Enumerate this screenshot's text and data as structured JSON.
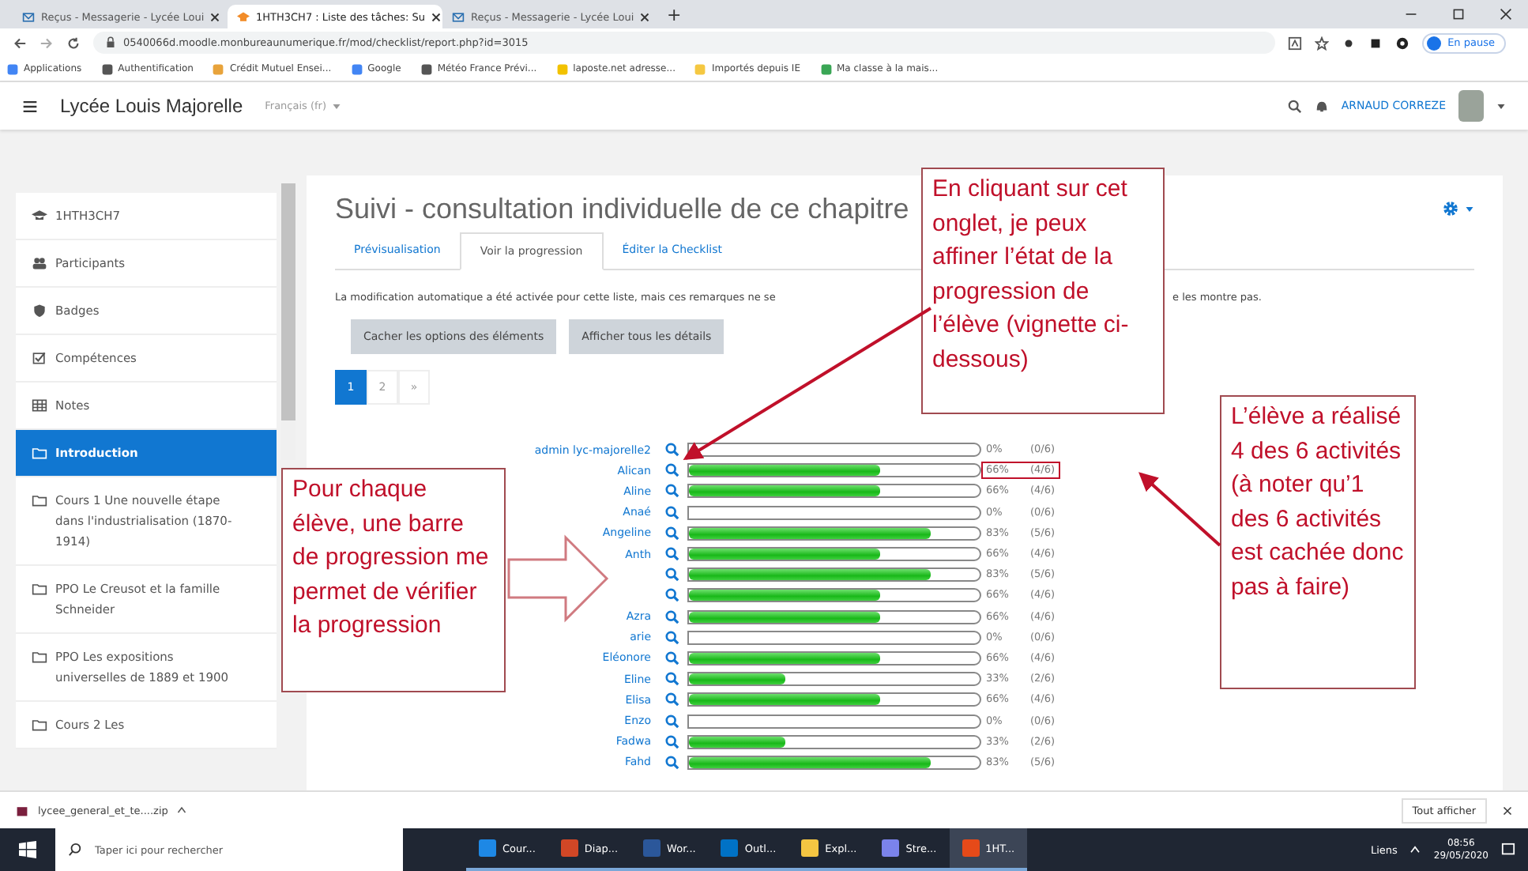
{
  "browser": {
    "tabs": [
      {
        "title": "Reçus - Messagerie - Lycée Loui",
        "kind": "mail",
        "selected": false
      },
      {
        "title": "1HTH3CH7 : Liste des tâches: Su",
        "kind": "course",
        "selected": true
      },
      {
        "title": "Reçus - Messagerie - Lycée Loui",
        "kind": "mail",
        "selected": false
      }
    ],
    "new_tab": "+",
    "url": "0540066d.moodle.monbureaunumerique.fr/mod/checklist/report.php?id=3015",
    "bookmarks": [
      {
        "label": "Applications",
        "color": "#4285f4"
      },
      {
        "label": "Authentification",
        "color": "#555555"
      },
      {
        "label": "Crédit Mutuel Ensei...",
        "color": "#e8a33b"
      },
      {
        "label": "Google",
        "color": "#4285f4"
      },
      {
        "label": "Météo France Prévi...",
        "color": "#555555"
      },
      {
        "label": "laposte.net adresse...",
        "color": "#f2c200"
      },
      {
        "label": "Importés depuis IE",
        "color": "#f5c842"
      },
      {
        "label": "Ma classe à la mais...",
        "color": "#3aa655"
      }
    ],
    "profile_badge": "En pause"
  },
  "header": {
    "site_name": "Lycée Louis Majorelle",
    "language": "Français (fr)",
    "user_name": "ARNAUD CORREZE"
  },
  "sidebar": {
    "items": [
      {
        "label": "1HTH3CH7",
        "kind": "course",
        "selected": false
      },
      {
        "label": "Participants",
        "kind": "participants",
        "selected": false
      },
      {
        "label": "Badges",
        "kind": "badges",
        "selected": false
      },
      {
        "label": "Compétences",
        "kind": "competencies",
        "selected": false
      },
      {
        "label": "Notes",
        "kind": "grades",
        "selected": false
      },
      {
        "label": "Introduction",
        "kind": "section",
        "selected": true
      },
      {
        "label": "Cours 1 Une nouvelle étape dans l'industrialisation (1870-1914)",
        "kind": "section",
        "selected": false
      },
      {
        "label": "PPO Le Creusot et la famille Schneider",
        "kind": "section",
        "selected": false
      },
      {
        "label": "PPO Les expositions universelles de 1889 et 1900",
        "kind": "section",
        "selected": false
      },
      {
        "label": "Cours 2 Les",
        "kind": "section",
        "selected": false
      }
    ]
  },
  "page": {
    "title": "Suivi - consultation individuelle de ce chapitre",
    "tabs": [
      {
        "label": "Prévisualisation",
        "selected": false
      },
      {
        "label": "Voir la progression",
        "selected": true
      },
      {
        "label": "Éditer la Checklist",
        "selected": false
      }
    ],
    "notice_start": "La modification automatique a été activée pour cette liste, mais ces remarques ne se",
    "notice_end": "e les montre pas.",
    "buttons": [
      "Cacher les options des éléments",
      "Afficher tous les détails"
    ],
    "pagination": [
      {
        "label": "1",
        "selected": true
      },
      {
        "label": "2",
        "selected": false
      },
      {
        "label": "»",
        "selected": false
      }
    ],
    "rows": [
      {
        "name": "admin lyc-majorelle2",
        "level": 0,
        "percent": "0%",
        "count": "(0/6)",
        "highlighted": false
      },
      {
        "name": "Alican",
        "level": 0.66,
        "percent": "66%",
        "count": "(4/6)",
        "highlighted": true
      },
      {
        "name": "Aline",
        "level": 0.66,
        "percent": "66%",
        "count": "(4/6)",
        "highlighted": false
      },
      {
        "name": "Anaé",
        "level": 0,
        "percent": "0%",
        "count": "(0/6)",
        "highlighted": false
      },
      {
        "name": "Angeline",
        "level": 0.83,
        "percent": "83%",
        "count": "(5/6)",
        "highlighted": false
      },
      {
        "name": "Anth",
        "level": 0.66,
        "percent": "66%",
        "count": "(4/6)",
        "highlighted": false
      },
      {
        "level": 0.83,
        "percent": "83%",
        "count": "(5/6)",
        "highlighted": false
      },
      {
        "level": 0.66,
        "percent": "66%",
        "count": "(4/6)",
        "highlighted": false
      },
      {
        "name": "Azra",
        "level": 0.66,
        "percent": "66%",
        "count": "(4/6)",
        "highlighted": false
      },
      {
        "name": "arie",
        "level": 0,
        "percent": "0%",
        "count": "(0/6)",
        "highlighted": false
      },
      {
        "name": "Eléonore",
        "level": 0.66,
        "percent": "66%",
        "count": "(4/6)",
        "highlighted": false
      },
      {
        "name": "Eline",
        "level": 0.33,
        "percent": "33%",
        "count": "(2/6)",
        "highlighted": false
      },
      {
        "name": "Elisa",
        "level": 0.66,
        "percent": "66%",
        "count": "(4/6)",
        "highlighted": false
      },
      {
        "name": "Enzo",
        "level": 0,
        "percent": "0%",
        "count": "(0/6)",
        "highlighted": false
      },
      {
        "name": "Fadwa",
        "level": 0.33,
        "percent": "33%",
        "count": "(2/6)",
        "highlighted": false
      },
      {
        "name": "Fahd",
        "level": 0.83,
        "percent": "83%",
        "count": "(5/6)",
        "highlighted": false
      }
    ]
  },
  "annotations": [
    {
      "kind": "callout",
      "text": "En cliquant sur cet onglet, je peux affiner l’état de la progression de l’élève (vignette ci-dessous)"
    },
    {
      "kind": "callout",
      "text": "Pour chaque élève, une barre de progression me permet de vérifier la progression"
    },
    {
      "kind": "callout",
      "text": "L’élève a réalisé 4 des 6 activités (à noter qu’1 des 6 activités est cachée donc pas à faire)"
    }
  ],
  "download_bar": {
    "file": "lycee_general_et_te....zip",
    "show_all": "Tout afficher"
  },
  "taskbar": {
    "search_placeholder": "Taper ici pour rechercher",
    "apps": [
      {
        "label": "Cour...",
        "color": "#1e88e5",
        "selected": false
      },
      {
        "label": "Diap...",
        "color": "#d24726",
        "selected": false
      },
      {
        "label": "Wor...",
        "color": "#2b579a",
        "selected": false
      },
      {
        "label": "Outl...",
        "color": "#0072c6",
        "selected": false
      },
      {
        "label": "Expl...",
        "color": "#f4c542",
        "selected": false
      },
      {
        "label": "Stre...",
        "color": "#7b83eb",
        "selected": false
      },
      {
        "label": "1HT...",
        "color": "#e64a19",
        "selected": true
      }
    ],
    "tray_label": "Liens",
    "time": "08:56",
    "date": "29/05/2020"
  }
}
